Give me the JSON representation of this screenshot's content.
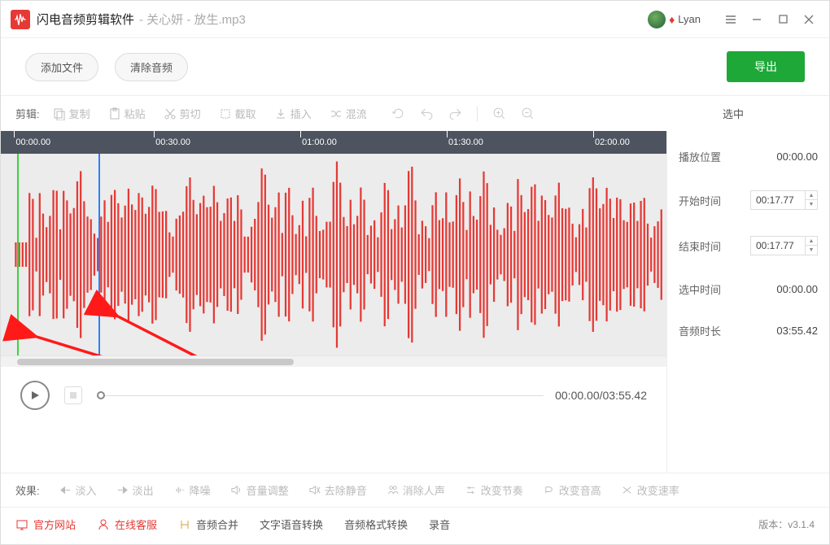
{
  "titlebar": {
    "app_title": "闪电音频剪辑软件",
    "file_title": " - 关心妍 - 放生.mp3",
    "username": "Lyan"
  },
  "toprow": {
    "add_file": "添加文件",
    "clear_audio": "清除音频",
    "export": "导出"
  },
  "toolbar": {
    "label": "剪辑:",
    "copy": "复制",
    "paste": "粘贴",
    "cut": "剪切",
    "crop": "截取",
    "insert": "插入",
    "mix": "混流"
  },
  "right_header": "选中",
  "ruler_marks": [
    {
      "label": "00:00.00",
      "pos": 2
    },
    {
      "label": "00:30.00",
      "pos": 23
    },
    {
      "label": "01:00.00",
      "pos": 45
    },
    {
      "label": "01:30.00",
      "pos": 67
    },
    {
      "label": "02:00.00",
      "pos": 89
    }
  ],
  "right_panel": {
    "play_pos_label": "播放位置",
    "play_pos_value": "00:00.00",
    "start_label": "开始时间",
    "start_value": "00:17.77",
    "end_label": "结束时间",
    "end_value": "00:17.77",
    "sel_label": "选中时间",
    "sel_value": "00:00.00",
    "dur_label": "音频时长",
    "dur_value": "03:55.42"
  },
  "playback": {
    "time": "00:00.00/03:55.42"
  },
  "effects": {
    "label": "效果:",
    "fade_in": "淡入",
    "fade_out": "淡出",
    "denoise": "降噪",
    "volume": "音量调整",
    "remove_silence": "去除静音",
    "remove_vocal": "消除人声",
    "tempo": "改变节奏",
    "pitch": "改变音高",
    "speed": "改变速率"
  },
  "bottom": {
    "site": "官方网站",
    "support": "在线客服",
    "merge": "音频合并",
    "tts": "文字语音转换",
    "format": "音频格式转换",
    "record": "录音",
    "version_label": "版本：",
    "version": "v3.1.4"
  }
}
